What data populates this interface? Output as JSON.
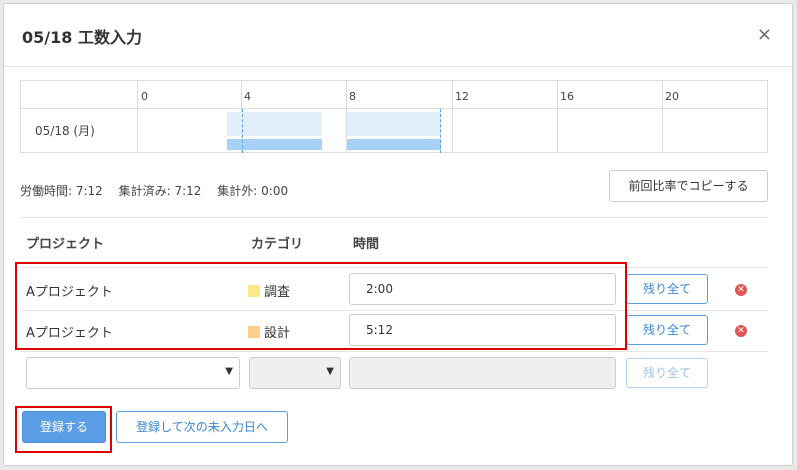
{
  "dialog": {
    "title": "05/18 工数入力",
    "close_glyph": "×"
  },
  "timeline": {
    "ticks": [
      "0",
      "4",
      "8",
      "12",
      "16",
      "20"
    ],
    "date_label": "05/18 (月)"
  },
  "summary": {
    "work_time": "労働時間: 7:12",
    "aggregated": "集計済み: 7:12",
    "not_aggregated": "集計外: 0:00"
  },
  "copy_button": "前回比率でコピーする",
  "table": {
    "headers": {
      "project": "プロジェクト",
      "category": "カテゴリ",
      "time": "時間"
    },
    "rows": [
      {
        "project": "Aプロジェクト",
        "category": "調査",
        "category_color": "#ffe98a",
        "time": "2:00",
        "rest_label": "残り全て"
      },
      {
        "project": "Aプロジェクト",
        "category": "設計",
        "category_color": "#ffce8a",
        "time": "5:12",
        "rest_label": "残り全て"
      }
    ],
    "new_row": {
      "rest_label": "残り全て"
    }
  },
  "footer": {
    "register": "登録する",
    "register_next": "登録して次の未入力日へ"
  },
  "colors": {
    "primary": "#5b9ee6",
    "highlight": "#e00000",
    "delete": "#e05555"
  }
}
